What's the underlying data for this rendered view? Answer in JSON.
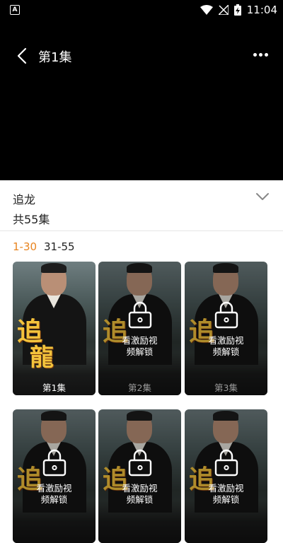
{
  "status_bar": {
    "time": "11:04",
    "app_icon_letter": "A"
  },
  "player": {
    "episode_title": "第1集"
  },
  "show": {
    "title": "追龙",
    "episode_count": "共55集"
  },
  "ranges": [
    {
      "label": "1-30",
      "active": true
    },
    {
      "label": "31-55",
      "active": false
    }
  ],
  "episodes": [
    {
      "label": "第1集",
      "locked": false
    },
    {
      "label": "第2集",
      "locked": true,
      "unlock_text_line1": "看激励视",
      "unlock_text_line2": "频解锁"
    },
    {
      "label": "第3集",
      "locked": true,
      "unlock_text_line1": "看激励视",
      "unlock_text_line2": "频解锁"
    },
    {
      "label": "",
      "locked": true,
      "unlock_text_line1": "看激励视",
      "unlock_text_line2": "频解锁"
    },
    {
      "label": "",
      "locked": true,
      "unlock_text_line1": "看激励视",
      "unlock_text_line2": "频解锁"
    },
    {
      "label": "",
      "locked": true,
      "unlock_text_line1": "看激励视",
      "unlock_text_line2": "频解锁"
    }
  ],
  "poster_logo": {
    "char1": "追",
    "char2": "龍"
  },
  "colors": {
    "accent": "#e8841f",
    "video_bg": "#000000"
  }
}
